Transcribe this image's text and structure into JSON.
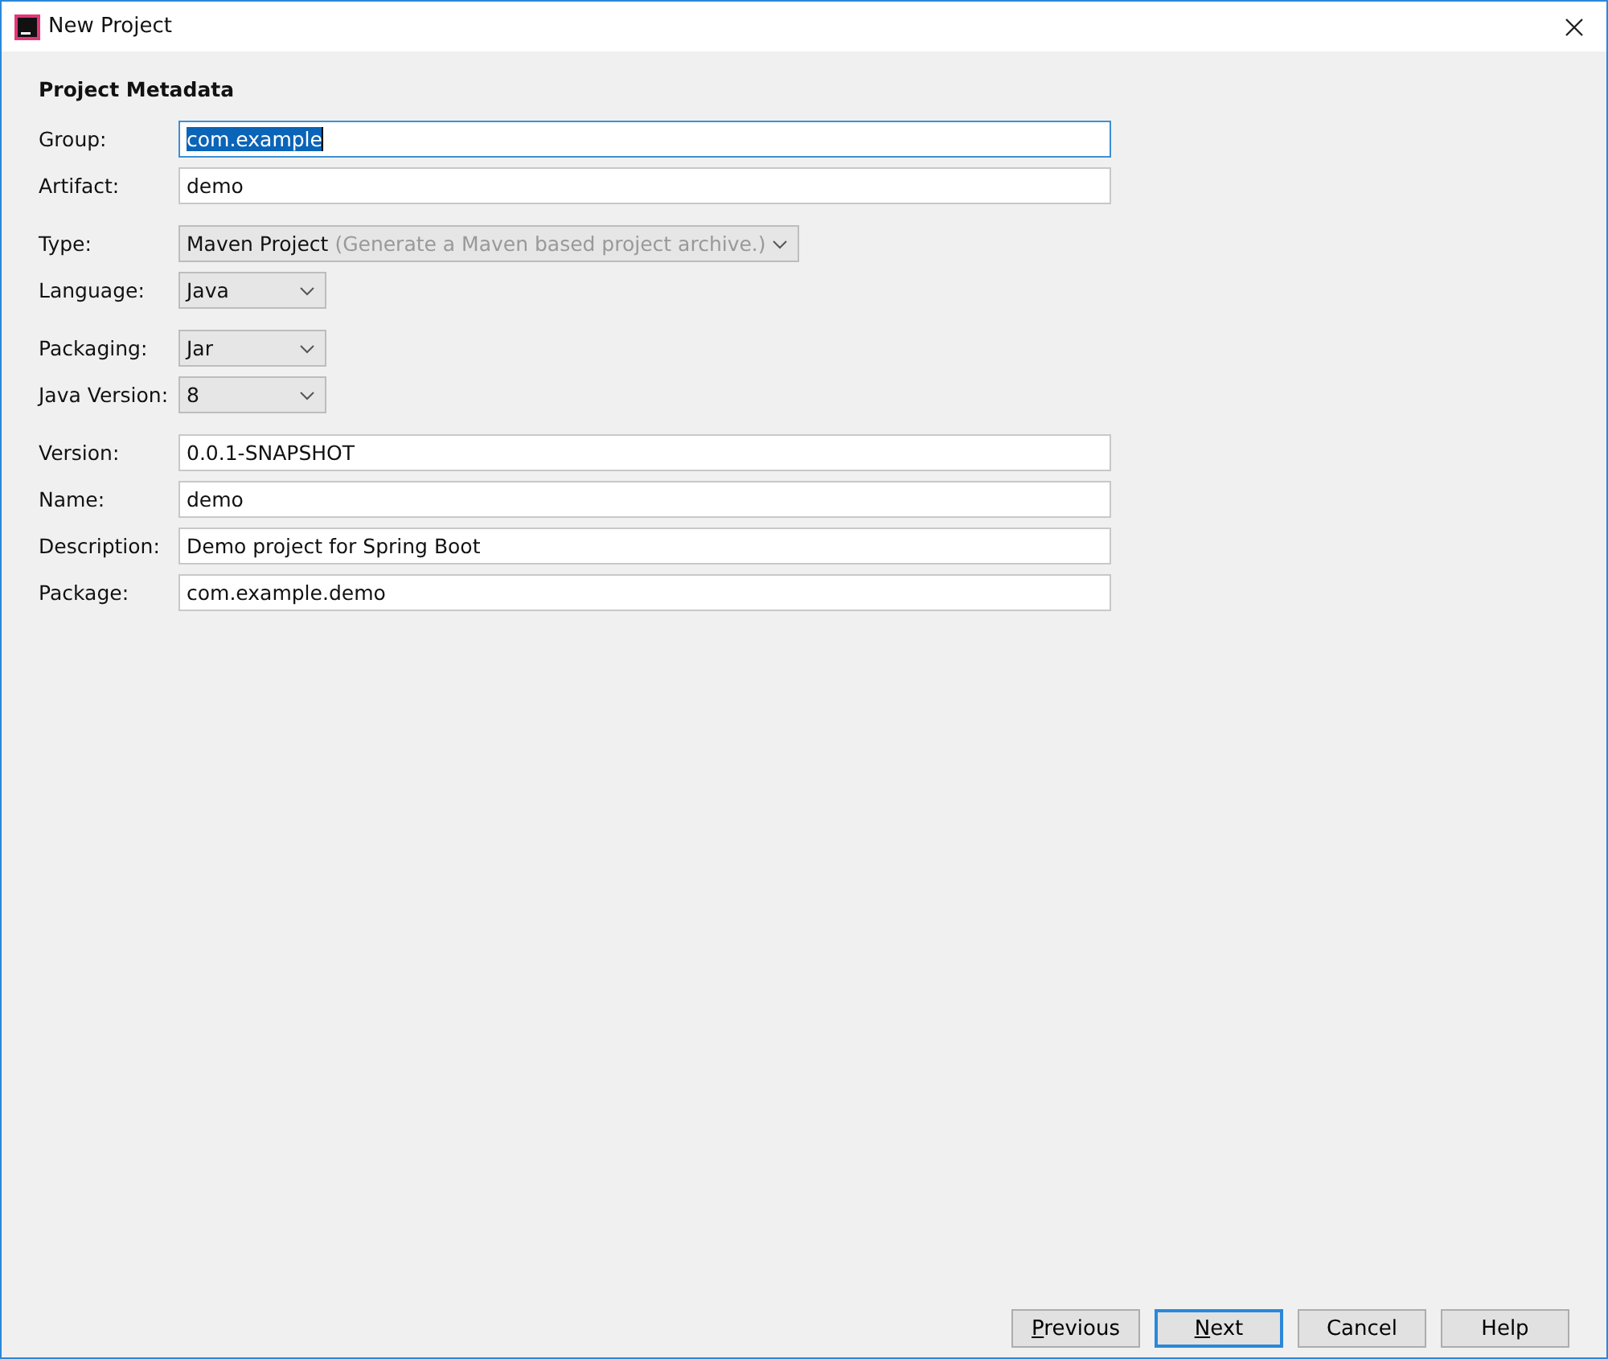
{
  "window": {
    "title": "New Project"
  },
  "section_title": "Project Metadata",
  "groups": [
    {
      "fields": [
        {
          "kind": "text",
          "label": "Group:",
          "value": "com.example",
          "focused": true,
          "text_selected": true
        },
        {
          "kind": "text",
          "label": "Artifact:",
          "value": "demo",
          "focused": false,
          "text_selected": false
        }
      ]
    },
    {
      "fields": [
        {
          "kind": "select",
          "label": "Type:",
          "value": "Maven Project",
          "hint": "(Generate a Maven based project archive.)"
        },
        {
          "kind": "select",
          "label": "Language:",
          "value": "Java"
        }
      ]
    },
    {
      "fields": [
        {
          "kind": "select",
          "label": "Packaging:",
          "value": "Jar"
        },
        {
          "kind": "select",
          "label": "Java Version:",
          "value": "8"
        }
      ]
    },
    {
      "fields": [
        {
          "kind": "text",
          "label": "Version:",
          "value": "0.0.1-SNAPSHOT",
          "focused": false,
          "text_selected": false
        },
        {
          "kind": "text",
          "label": "Name:",
          "value": "demo",
          "focused": false,
          "text_selected": false
        },
        {
          "kind": "text",
          "label": "Description:",
          "value": "Demo project for Spring Boot",
          "focused": false,
          "text_selected": false
        },
        {
          "kind": "text",
          "label": "Package:",
          "value": "com.example.demo",
          "focused": false,
          "text_selected": false
        }
      ]
    }
  ],
  "buttons": [
    {
      "label": "Previous",
      "mnemonic_first": true,
      "default": false
    },
    {
      "label": "Next",
      "mnemonic_first": true,
      "default": true
    },
    {
      "label": "Cancel",
      "mnemonic_first": false,
      "default": false
    },
    {
      "label": "Help",
      "mnemonic_first": false,
      "default": false
    }
  ]
}
